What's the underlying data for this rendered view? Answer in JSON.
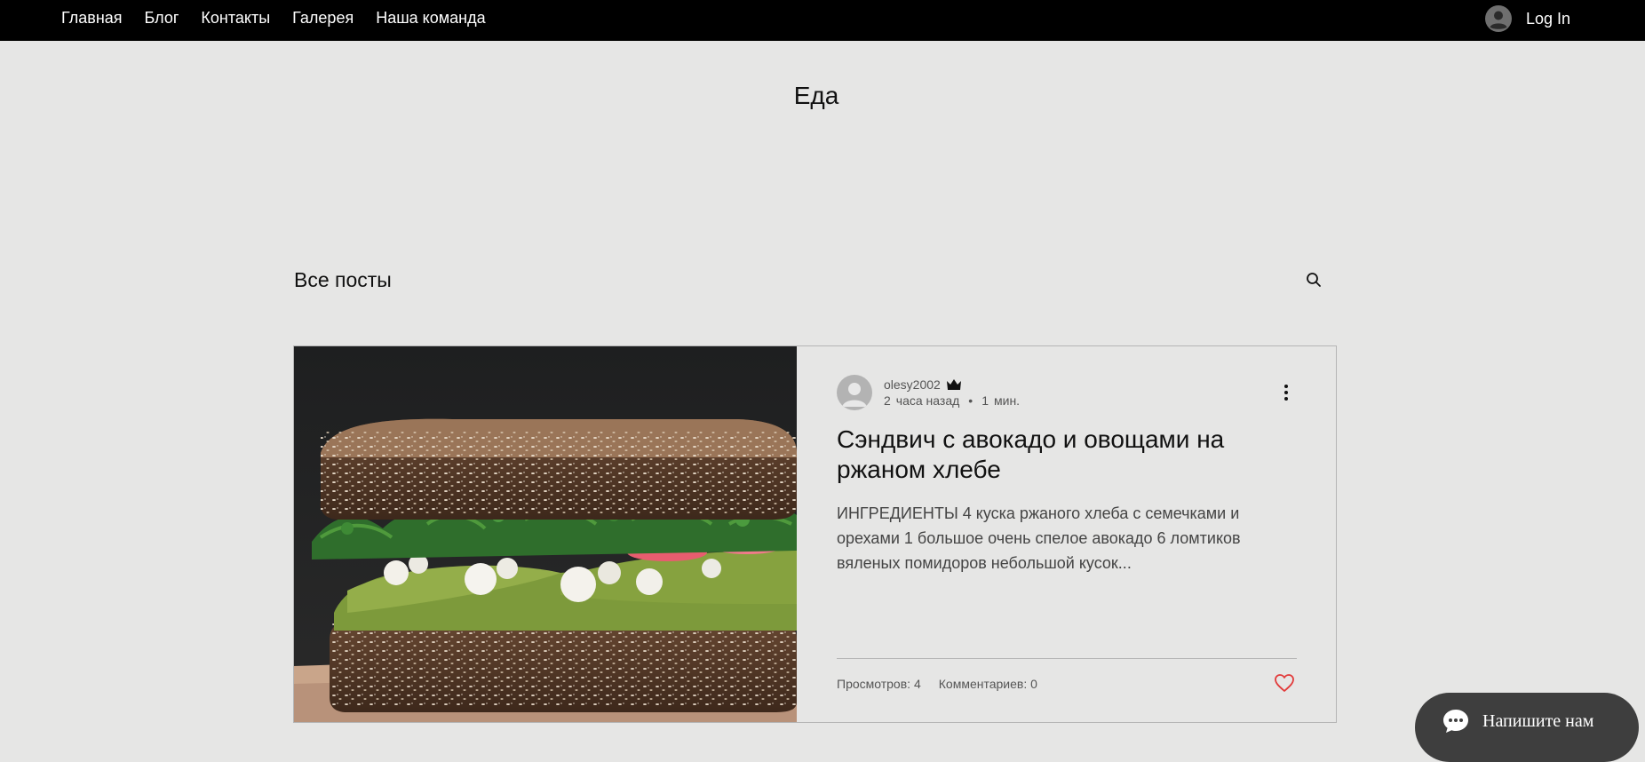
{
  "nav": {
    "items": [
      {
        "label": "Главная"
      },
      {
        "label": "Блог"
      },
      {
        "label": "Контакты"
      },
      {
        "label": "Галерея"
      },
      {
        "label": "Наша команда"
      }
    ],
    "login_label": "Log In"
  },
  "page": {
    "title": "Еда"
  },
  "posts_header": {
    "all_posts_label": "Все посты",
    "search_icon": "search-icon"
  },
  "post": {
    "author": "olesy2002",
    "author_badge_icon": "crown-icon",
    "time_number": "2",
    "time_text": "часа назад",
    "separator": "•",
    "read_number": "1",
    "read_text": "мин.",
    "title": "Сэндвич с авокадо и овощами на ржаном хлебе",
    "excerpt": "ИНГРЕДИЕНТЫ 4 куска ржаного хлеба с семечками и орехами 1 большое очень спелое авокадо 6 ломтиков вяленых помидоров небольшой кусок...",
    "views_label": "Просмотров:",
    "views_value": "4",
    "comments_label": "Комментариев:",
    "comments_value": "0",
    "like_icon": "heart-icon",
    "like_color": "#e23a3a"
  },
  "chat": {
    "label": "Напишите нам"
  },
  "colors": {
    "background": "#e6e6e5",
    "topbar": "#000000",
    "chat_bg": "#3e3e3e"
  }
}
